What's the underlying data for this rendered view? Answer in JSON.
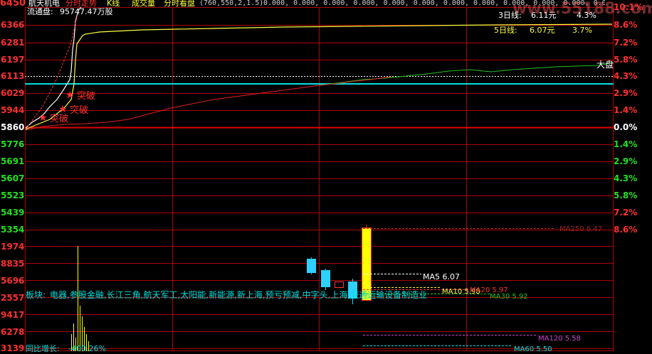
{
  "colors": {
    "background": "#000000",
    "grid_red": "#c00000",
    "up": "#ff3030",
    "down": "#2ed0ff",
    "neutral": "#ffffff",
    "yellow": "#ffff00",
    "green_line": "#20c020",
    "cyan": "#00e0e0",
    "magenta": "#d040d0"
  },
  "header": {
    "stock_name": "航天机电",
    "label_chart": "分时走势",
    "label_k": "K线",
    "label_volume": "成交量",
    "label_tick": "分时看盘",
    "params": "(760,550,2,1.5)",
    "zeros": "0.000, 0.000, 0.000, 0.000, 0.000, 0.000, 0.000, 0.000, 0.000, 0.000, 0.000, 0.000, 0.000, 0.000,",
    "float_shares_label": "流通盘:",
    "float_shares_value": "95747.47万股"
  },
  "price_axis_left": [
    "6450",
    "6366",
    "6281",
    "6197",
    "6113",
    "6029",
    "5944",
    "5860",
    "5776",
    "5691",
    "5607",
    "5523",
    "5439",
    "5354"
  ],
  "price_axis_right": [
    "10.1%",
    "8.6%",
    "7.2%",
    "5.8%",
    "4.3%",
    "2.9%",
    "1.4%",
    "0.0%",
    "1.4%",
    "2.9%",
    "4.3%",
    "5.8%",
    "7.2%",
    "8.6%"
  ],
  "volume_axis_left": [
    "1974",
    "8835",
    "5696",
    "2557",
    "9417",
    "6278",
    "3139"
  ],
  "overlays": {
    "line3": {
      "label": "3日线:",
      "value": "6.11元",
      "pct": "4.3%"
    },
    "line5": {
      "label": "5日线:",
      "value": "6.07元",
      "pct": "3.7%"
    },
    "market": "大盘",
    "breakthrough": "突破",
    "watermark": "www.55188.com"
  },
  "lower": {
    "sector_label": "板块:",
    "sectors": "电器,参股金融,长江三角,航天军工,太阳能,新能源,新上海,预亏预减,中字头,上海,交通运输设备制造业",
    "growth_label": "同比增长:",
    "growth_value": "-400.26%",
    "ma_labels": {
      "ma5": "MA5 6.07",
      "ma10": "MA10 5.98",
      "ma20": "MA20 5.97",
      "ma30": "MA30 5.92",
      "ma120": "MA120 5.58",
      "ma60": "MA60 5.50",
      "ma250": "MA250 6.47"
    }
  }
}
